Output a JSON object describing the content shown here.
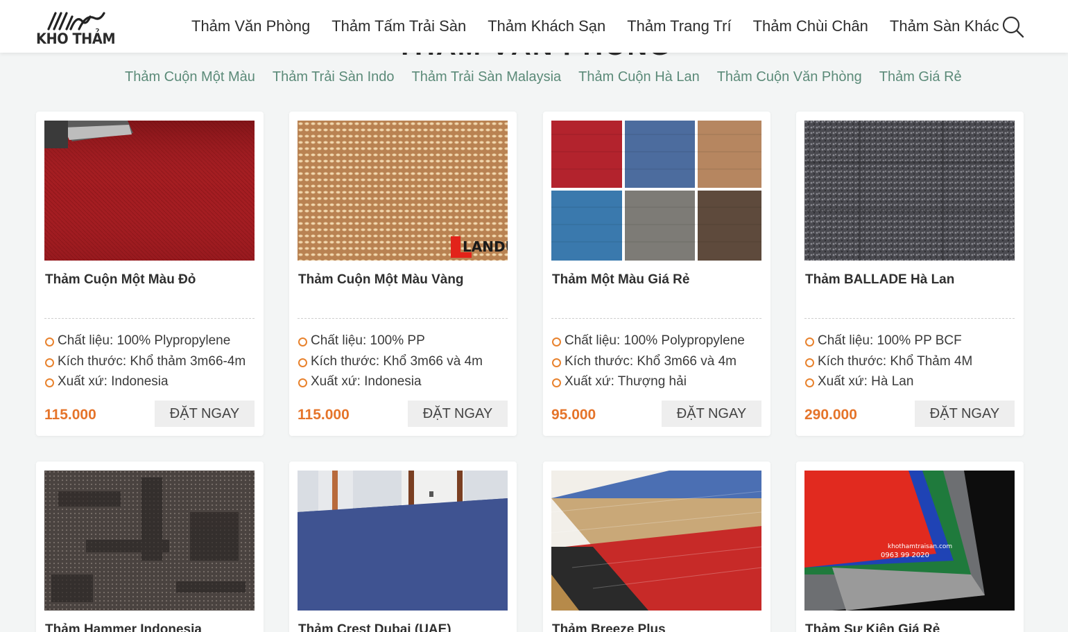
{
  "brand": {
    "name": "KHO THẢM"
  },
  "nav": [
    "Thảm Văn Phòng",
    "Thảm Tấm Trải Sàn",
    "Thảm Khách Sạn",
    "Thảm Trang Trí",
    "Thảm Chùi Chân",
    "Thảm Sàn Khác"
  ],
  "section_title": "THẢM VĂN PHÒNG",
  "subnav": [
    "Thảm Cuộn Một Màu",
    "Thảm Trải Sàn Indo",
    "Thảm Trải Sàn Malaysia",
    "Thảm Cuộn Hà Lan",
    "Thảm Cuộn Văn Phòng",
    "Thảm Giá Rẻ"
  ],
  "order_label": "ĐẶT NGAY",
  "products": [
    {
      "name": "Thảm Cuộn Một Màu Đỏ",
      "specs": [
        "Chất liệu: 100% Plypropylene",
        "Kích thước: Khổ thảm 3m66-4m",
        "Xuất xứ: Indonesia"
      ],
      "price": "115.000",
      "image": "red-carpet-photo"
    },
    {
      "name": "Thảm Cuộn Một Màu Vàng",
      "specs": [
        "Chất liệu: 100% PP",
        "Kích thước: Khổ 3m66 và 4m",
        "Xuất xứ: Indonesia"
      ],
      "price": "115.000",
      "image": "beige-loop-carpet-photo",
      "watermark": "LANDU"
    },
    {
      "name": "Thảm Một Màu Giá Rẻ",
      "specs": [
        "Chất liệu: 100% Polypropylene",
        "Kích thước: Khổ 3m66 và 4m",
        "Xuất xứ: Thượng hải"
      ],
      "price": "95.000",
      "image": "six-color-carpet-swatches"
    },
    {
      "name": "Thảm BALLADE Hà Lan",
      "specs": [
        "Chất liệu: 100% PP BCF",
        "Kích thước: Khổ Thảm 4M",
        "Xuất xứ: Hà Lan"
      ],
      "price": "290.000",
      "image": "grey-carpet-photo"
    },
    {
      "name": "Thảm Hammer Indonesia",
      "image": "dark-pattern-carpet-photo"
    },
    {
      "name": "Thảm Crest Dubai (UAE)",
      "image": "blue-office-carpet-photo"
    },
    {
      "name": "Thảm Breeze Plus",
      "image": "multi-color-carpet-fan-photo"
    },
    {
      "name": "Thảm Sự Kiện Giá Rẻ",
      "image": "event-carpet-colors-photo",
      "image_text": [
        "khothamtraisan.com",
        "0963 99 2020"
      ]
    }
  ],
  "colors": {
    "accent": "#e5742a",
    "subnav": "#5b8a78",
    "page_bg": "#f3f5f5"
  }
}
